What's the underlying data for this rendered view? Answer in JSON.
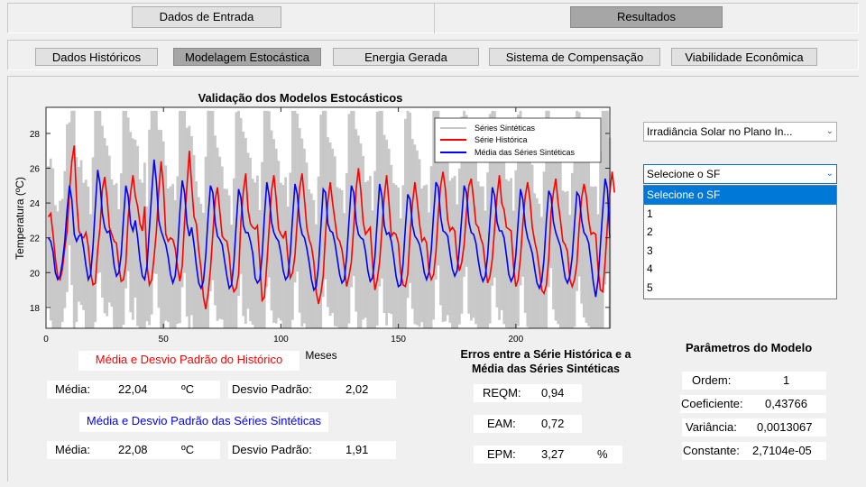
{
  "top_buttons": {
    "input": "Dados de Entrada",
    "results": "Resultados"
  },
  "tabs": [
    "Dados Históricos",
    "Modelagem Estocástica",
    "Energia Gerada",
    "Sistema de Compensação",
    "Viabilidade Econômica"
  ],
  "chart_data": {
    "type": "line",
    "title": "Validação dos Modelos Estocásticos",
    "xlabel": "Meses",
    "ylabel": "Temperatura (ºC)",
    "xlim": [
      0,
      240
    ],
    "ylim": [
      16.8,
      29.5
    ],
    "xticks": [
      0,
      50,
      100,
      150,
      200
    ],
    "yticks": [
      18,
      20,
      22,
      24,
      26,
      28
    ],
    "grid": false,
    "legend_position": "top-right",
    "series": [
      {
        "name": "Séries Sintéticas",
        "color": "#c8c8c8",
        "style": "band",
        "min": 16.8,
        "max": 29.3
      },
      {
        "name": "Série Histórica",
        "color": "#ff0000"
      },
      {
        "name": "Média das Séries Sintéticas",
        "color": "#0000ff"
      }
    ],
    "historical": [
      23.2,
      23.4,
      22.2,
      20.8,
      19.8,
      19.6,
      20.2,
      21.4,
      22.4,
      24.6,
      26.4,
      27.3,
      24.2,
      22.4,
      22.1,
      22.0,
      22.3,
      21.5,
      20.0,
      19.3,
      19.4,
      21.3,
      22.6,
      24.8,
      25.5,
      24.3,
      22.6,
      22.2,
      21.8,
      21.7,
      20.4,
      19.5,
      19.6,
      20.5,
      23.2,
      24.6,
      25.6,
      24.4,
      23.8,
      22.8,
      22.4,
      23.8,
      20.4,
      19.3,
      19.6,
      20.9,
      22.4,
      24.7,
      26.4,
      24.9,
      22.2,
      21.8,
      22.0,
      21.9,
      21.4,
      20.3,
      19.5,
      20.4,
      22.9,
      25.0,
      27.0,
      25.0,
      23.2,
      22.8,
      21.3,
      20.2,
      18.6,
      17.9,
      18.8,
      20.2,
      22.2,
      24.2,
      24.9,
      23.5,
      22.1,
      21.9,
      21.8,
      21.0,
      19.4,
      18.9,
      19.1,
      19.9,
      23.0,
      24.7,
      25.7,
      23.6,
      22.8,
      22.6,
      22.5,
      22.7,
      20.6,
      18.4,
      18.6,
      20.5,
      22.6,
      24.7,
      25.6,
      24.2,
      22.5,
      22.2,
      22.0,
      22.4,
      20.8,
      19.7,
      20.0,
      21.0,
      23.1,
      24.9,
      25.7,
      24.2,
      22.6,
      21.9,
      21.5,
      20.6,
      18.9,
      18.2,
      18.8,
      19.8,
      22.3,
      24.1,
      25.2,
      24.0,
      23.0,
      22.0,
      21.8,
      21.3,
      20.3,
      19.2,
      19.8,
      20.6,
      22.6,
      24.8,
      26.0,
      24.7,
      22.9,
      22.2,
      22.4,
      22.6,
      20.5,
      19.0,
      19.6,
      20.6,
      22.5,
      24.4,
      25.6,
      24.0,
      22.1,
      22.3,
      22.2,
      21.7,
      20.0,
      19.3,
      19.2,
      19.9,
      22.2,
      24.0,
      25.2,
      24.1,
      22.8,
      21.8,
      22.0,
      21.7,
      20.1,
      19.6,
      19.9,
      21.2,
      23.4,
      25.0,
      25.8,
      24.8,
      23.0,
      22.4,
      22.6,
      22.4,
      20.8,
      20.1,
      20.6,
      21.6,
      23.5,
      25.0,
      25.4,
      24.2,
      22.8,
      22.6,
      22.0,
      21.6,
      20.4,
      19.4,
      19.8,
      20.8,
      22.6,
      24.4,
      25.6,
      24.0,
      23.6,
      22.6,
      22.5,
      22.4,
      20.4,
      19.2,
      19.6,
      20.9,
      22.8,
      24.4,
      25.2,
      24.2,
      22.6,
      21.8,
      21.2,
      20.2,
      19.0,
      18.8,
      19.3,
      20.8,
      23.5,
      24.6,
      25.4,
      24.0,
      23.0,
      21.8,
      21.6,
      21.2,
      19.6,
      19.2,
      19.6,
      20.5,
      22.7,
      24.3,
      25.1,
      24.4,
      23.0,
      22.2,
      22.3,
      22.2,
      20.2,
      19.0,
      18.9,
      20.6,
      22.8,
      24.6,
      25.8,
      24.6
    ],
    "synthetic_mean": [
      22.0,
      21.8,
      21.2,
      20.0,
      19.6,
      19.8,
      20.6,
      21.8,
      23.6,
      25.0,
      24.2,
      22.2,
      21.8,
      22.1,
      22.2,
      21.4,
      20.4,
      19.6,
      19.9,
      21.5,
      23.8,
      25.9,
      25.1,
      23.4,
      22.6,
      22.3,
      22.4,
      21.6,
      20.4,
      19.8,
      20.0,
      21.0,
      23.1,
      25.0,
      24.4,
      22.8,
      22.4,
      23.0,
      22.0,
      20.7,
      19.8,
      19.6,
      20.4,
      22.5,
      24.6,
      26.5,
      25.2,
      23.0,
      22.4,
      22.0,
      21.6,
      20.9,
      19.9,
      19.4,
      19.8,
      21.2,
      23.5,
      25.3,
      24.6,
      22.8,
      22.1,
      22.6,
      21.6,
      20.4,
      19.4,
      19.1,
      19.5,
      21.0,
      23.2,
      25.0,
      24.6,
      22.9,
      22.1,
      21.9,
      21.6,
      20.7,
      19.8,
      19.1,
      19.3,
      20.6,
      22.8,
      24.8,
      24.3,
      22.7,
      22.3,
      22.3,
      21.8,
      21.1,
      19.7,
      19.4,
      19.6,
      21.0,
      23.3,
      25.2,
      24.4,
      22.9,
      22.3,
      22.0,
      21.8,
      21.1,
      20.1,
      19.6,
      19.8,
      21.1,
      23.2,
      25.1,
      24.5,
      22.9,
      22.2,
      22.0,
      21.4,
      20.6,
      19.6,
      19.0,
      19.2,
      20.4,
      22.6,
      24.8,
      24.6,
      22.8,
      22.4,
      22.3,
      21.7,
      20.8,
      19.9,
      19.4,
      19.6,
      20.9,
      23.0,
      25.0,
      24.6,
      22.9,
      22.2,
      22.0,
      21.9,
      21.2,
      20.1,
      19.5,
      19.7,
      20.9,
      23.0,
      25.1,
      24.4,
      22.7,
      22.2,
      22.3,
      21.8,
      20.9,
      19.8,
      19.2,
      19.3,
      20.5,
      22.6,
      24.5,
      24.2,
      22.7,
      22.1,
      21.9,
      21.6,
      20.9,
      20.0,
      19.6,
      20.0,
      21.3,
      23.4,
      25.2,
      24.9,
      23.2,
      22.4,
      22.3,
      22.1,
      21.1,
      20.2,
      19.8,
      20.1,
      21.4,
      23.2,
      25.0,
      24.6,
      22.9,
      22.3,
      22.2,
      21.7,
      20.7,
      19.9,
      19.5,
      19.8,
      21.0,
      23.0,
      24.9,
      24.4,
      22.9,
      22.4,
      22.4,
      22.0,
      21.0,
      19.9,
      19.5,
      19.8,
      21.0,
      22.9,
      24.8,
      24.2,
      22.7,
      22.0,
      21.6,
      21.1,
      20.2,
      19.4,
      19.1,
      19.5,
      20.8,
      23.0,
      24.7,
      24.4,
      22.9,
      22.3,
      21.9,
      21.5,
      20.6,
      19.7,
      19.4,
      19.8,
      20.9,
      22.8,
      24.6,
      24.4,
      23.0,
      22.3,
      22.1,
      21.7,
      20.6,
      19.4,
      18.6,
      19.6,
      21.6,
      23.6,
      25.4,
      24.8,
      22.0
    ]
  },
  "historic_stats": {
    "title": "Média e Desvio Padrão do Histórico",
    "mean_label": "Média:",
    "mean_value": "22,04",
    "unit": "ºC",
    "std_label": "Desvio Padrão:",
    "std_value": "2,02"
  },
  "synthetic_stats": {
    "title": "Média e Desvio Padrão das Séries Sintéticas",
    "mean_label": "Média:",
    "mean_value": "22,08",
    "unit": "ºC",
    "std_label": "Desvio Padrão:",
    "std_value": "1,91"
  },
  "errors": {
    "title_line1": "Erros entre a Série Histórica e a",
    "title_line2": "Média das Séries Sintéticas",
    "reqm_label": "REQM:",
    "reqm_value": "0,94",
    "eam_label": "EAM:",
    "eam_value": "0,72",
    "epm_label": "EPM:",
    "epm_value": "3,27",
    "epm_unit": "%"
  },
  "params": {
    "title": "Parâmetros do Modelo",
    "order_label": "Ordem:",
    "order_value": "1",
    "coef_label": "Coeficiente:",
    "coef_value": "0,43766",
    "var_label": "Variância:",
    "var_value": "0,0013067",
    "const_label": "Constante:",
    "const_value": "2,7104e-05"
  },
  "variable_select": {
    "value": "Irradiância Solar no Plano In..."
  },
  "sf_select": {
    "value": "Selecione o SF",
    "options": [
      "Selecione o SF",
      "1",
      "2",
      "3",
      "4",
      "5"
    ]
  }
}
